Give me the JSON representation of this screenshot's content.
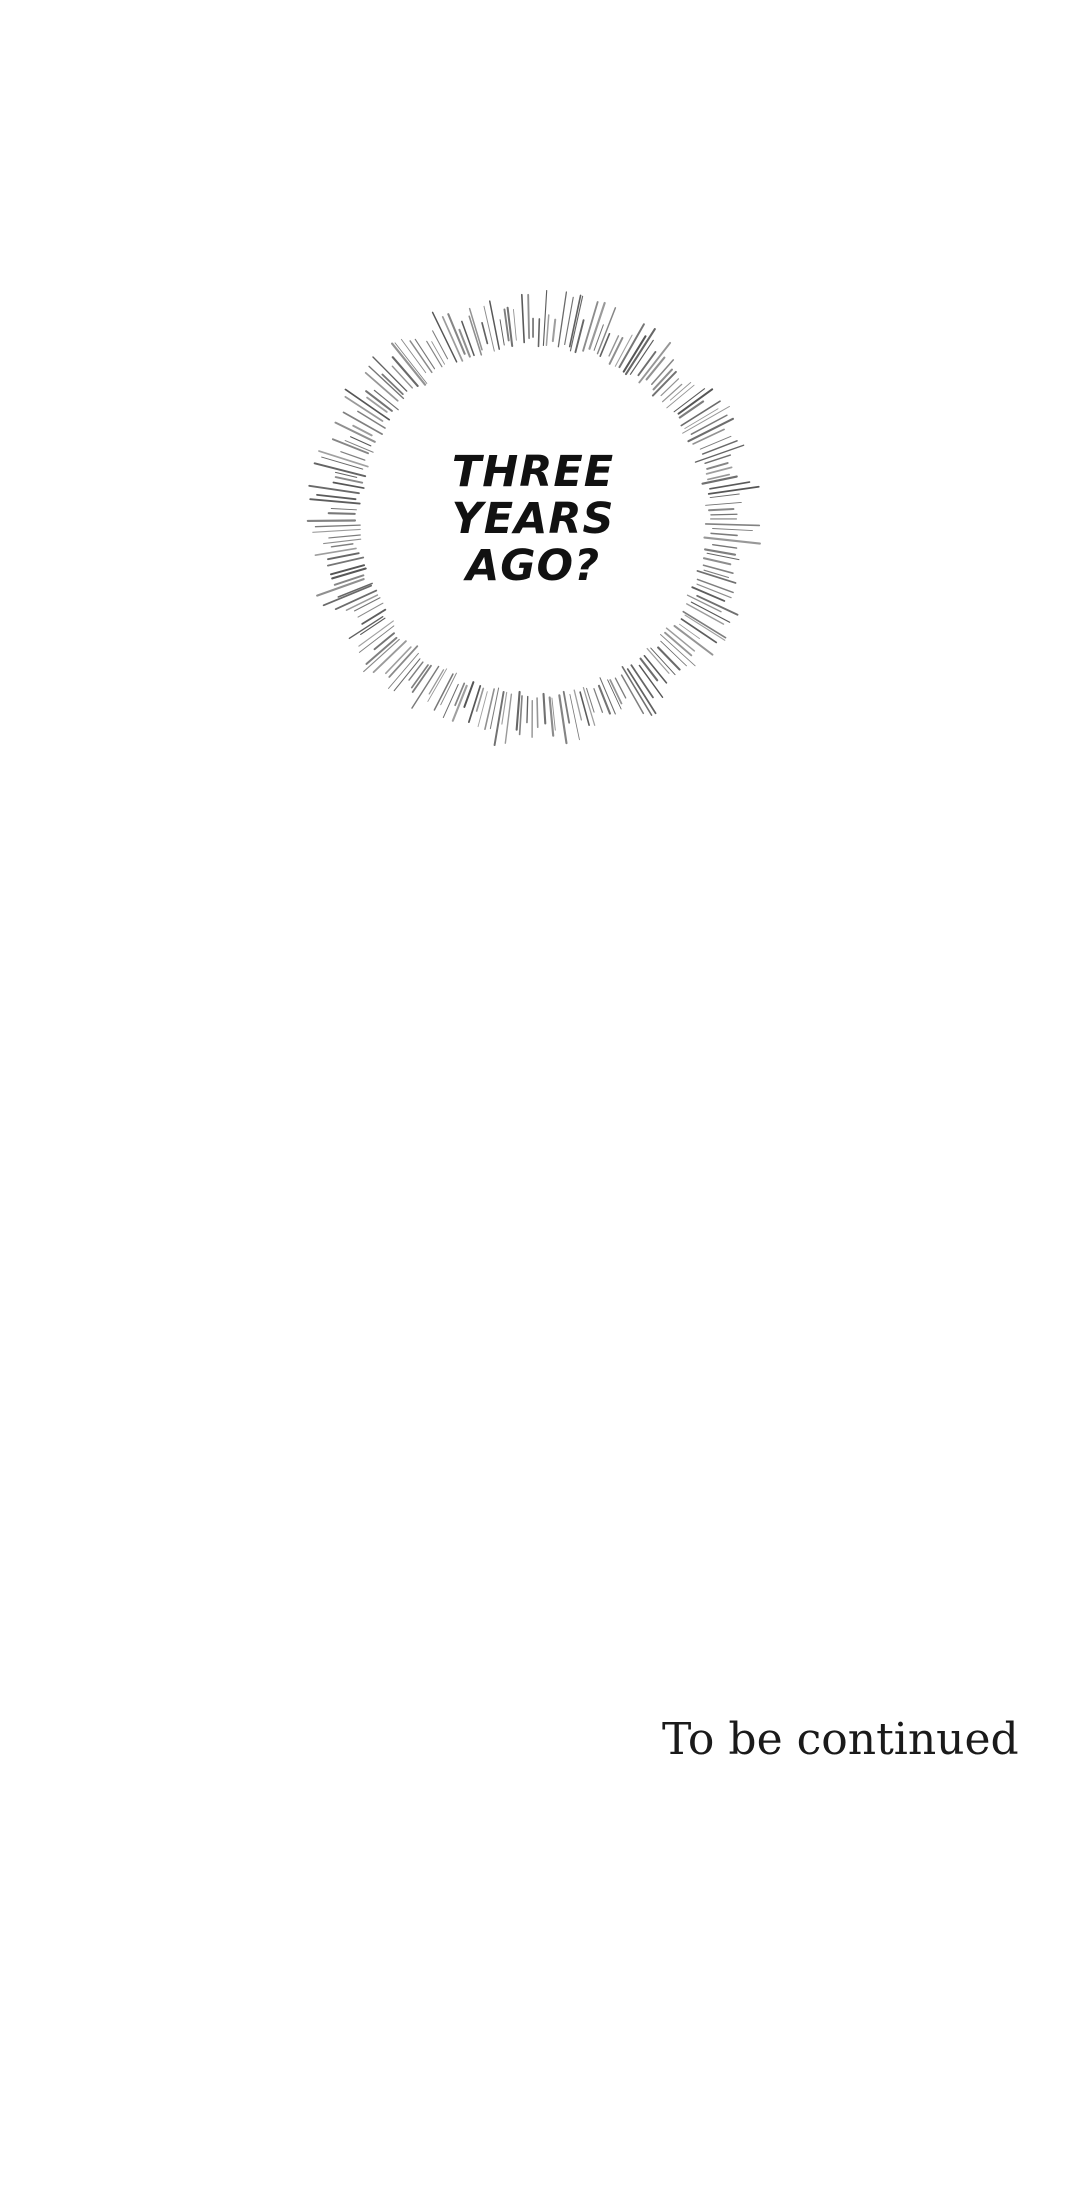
{
  "burst": {
    "lines": [
      "THREE",
      "YEARS",
      "AGO?"
    ]
  },
  "ending": {
    "text": "To be continued"
  },
  "colors": {
    "background": "#ffffff",
    "ink": "#111111",
    "burst_lines": "#555555"
  }
}
